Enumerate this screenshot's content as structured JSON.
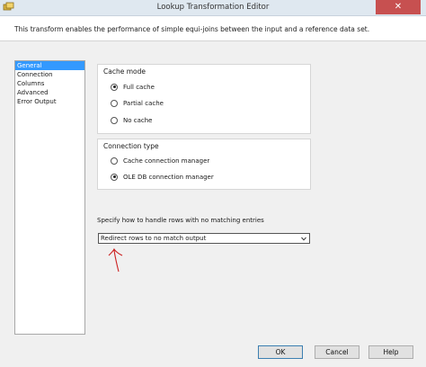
{
  "window": {
    "title": "Lookup Transformation Editor",
    "close_glyph": "✕",
    "app_icon": "ssis-transform-icon"
  },
  "description": "This transform enables the performance of simple equi-joins between the input and a reference data set.",
  "nav": {
    "items": [
      {
        "label": "General",
        "selected": true
      },
      {
        "label": "Connection",
        "selected": false
      },
      {
        "label": "Columns",
        "selected": false
      },
      {
        "label": "Advanced",
        "selected": false
      },
      {
        "label": "Error Output",
        "selected": false
      }
    ]
  },
  "cache_mode": {
    "title": "Cache mode",
    "options": [
      {
        "label": "Full cache",
        "checked": true
      },
      {
        "label": "Partial cache",
        "checked": false
      },
      {
        "label": "No cache",
        "checked": false
      }
    ]
  },
  "connection_type": {
    "title": "Connection type",
    "options": [
      {
        "label": "Cache connection manager",
        "checked": false
      },
      {
        "label": "OLE DB connection manager",
        "checked": true
      }
    ]
  },
  "no_match": {
    "label": "Specify how to handle rows with no matching entries",
    "selected": "Redirect rows to no match output"
  },
  "buttons": {
    "ok": "OK",
    "cancel": "Cancel",
    "help": "Help"
  },
  "colors": {
    "selection": "#3399ff",
    "annotation": "#cc2222",
    "close": "#c75050"
  }
}
